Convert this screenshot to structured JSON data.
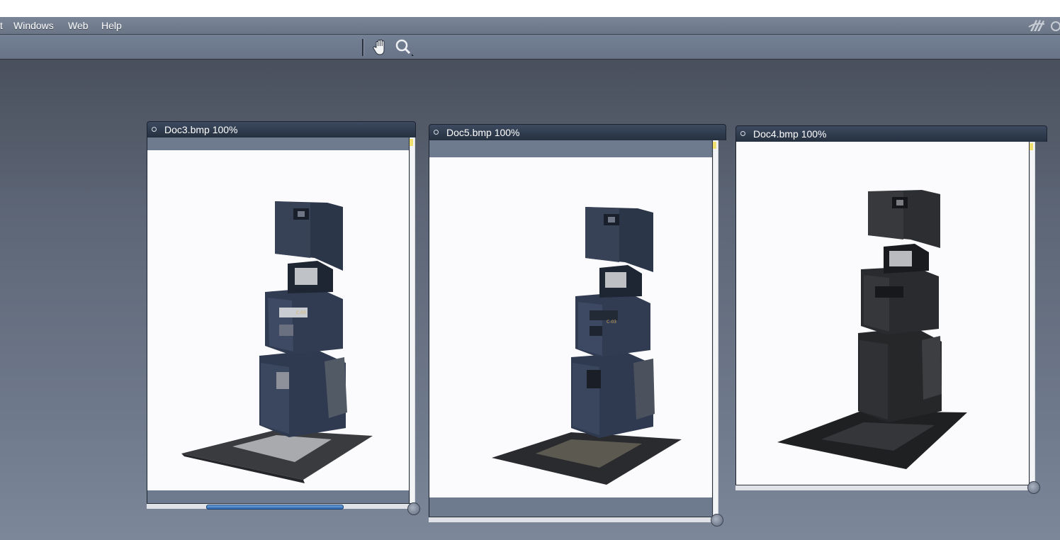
{
  "menu": {
    "partial": "t",
    "windows": "Windows",
    "web": "Web",
    "help": "Help"
  },
  "toolbar": {
    "tools": [
      {
        "name": "hand-tool",
        "icon": "hand-icon"
      },
      {
        "name": "zoom-tool",
        "icon": "magnifier-icon"
      }
    ]
  },
  "documents": [
    {
      "title": "Doc3.bmp 100%",
      "finish": "matte blue-gray"
    },
    {
      "title": "Doc5.bmp 100%",
      "finish": "glossy blue-gray"
    },
    {
      "title": "Doc4.bmp 100%",
      "finish": "dark metallic"
    }
  ],
  "colors": {
    "menu_text": "#ffffff",
    "titlebar": "#25303f",
    "canvas_bg": "#fbfbfd",
    "scroll_thumb": "#2e66ad"
  }
}
